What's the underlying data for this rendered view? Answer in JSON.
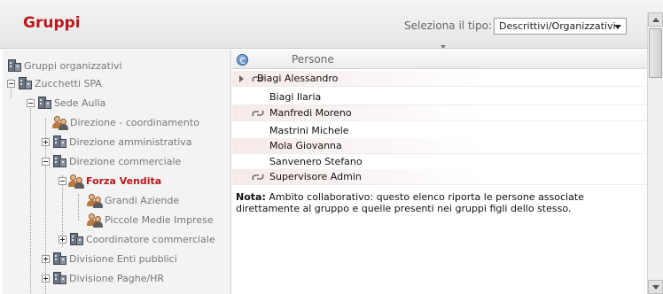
{
  "header": {
    "title": "Gruppi",
    "type_label": "Seleziona il tipo:",
    "type_select_value": "Descrittivi/Organizzativi"
  },
  "tree": {
    "items": [
      {
        "label": "Gruppi organizzativi",
        "icon": "building-icon"
      },
      {
        "label": "Zucchetti SPA",
        "icon": "building-icon"
      },
      {
        "label": "Sede Aulla",
        "icon": "building-icon"
      },
      {
        "label": "Direzione - coordinamento",
        "icon": "people-icon"
      },
      {
        "label": "Direzione amministrativa",
        "icon": "building-icon"
      },
      {
        "label": "Direzione commerciale",
        "icon": "building-icon"
      },
      {
        "label": "Forza Vendita",
        "icon": "people-icon"
      },
      {
        "label": "Grandi Aziende",
        "icon": "people-icon"
      },
      {
        "label": "Piccole Medie Imprese",
        "icon": "people-icon"
      },
      {
        "label": "Coordinatore commerciale",
        "icon": "building-icon"
      },
      {
        "label": "Divisione Enti pubblici",
        "icon": "building-icon"
      },
      {
        "label": "Divisione Paghe/HR",
        "icon": "building-icon"
      }
    ]
  },
  "list": {
    "column_header": "Persone",
    "rows": [
      {
        "name": "Biagi Alessandro"
      },
      {
        "name": "Biagi Ilaria"
      },
      {
        "name": "Manfredi Moreno"
      },
      {
        "name": "Mastrini Michele"
      },
      {
        "name": "Mola Giovanna"
      },
      {
        "name": "Sanvenero Stefano"
      },
      {
        "name": "Supervisore Admin"
      }
    ],
    "note_label": "Nota:",
    "note_text": "Ambito collaborativo: questo elenco riporta le persone associate direttamente al gruppo e quelle presenti nei gruppi figli dello stesso."
  },
  "colors": {
    "accent": "#b8181e",
    "row_shade": "#f6e9e9"
  }
}
